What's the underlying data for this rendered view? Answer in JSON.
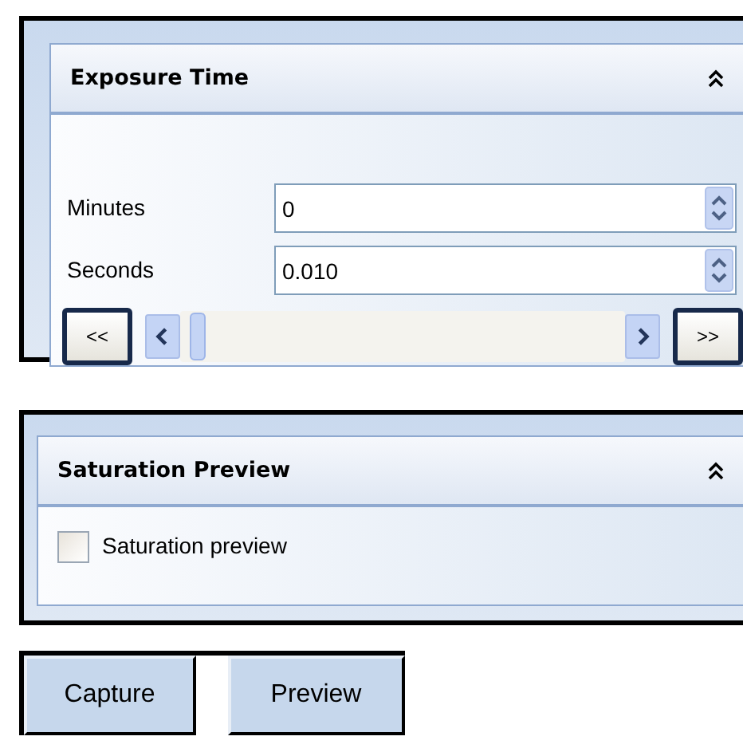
{
  "exposure_panel": {
    "title": "Exposure Time",
    "fields": [
      {
        "label": "Minutes",
        "value": "0"
      },
      {
        "label": "Seconds",
        "value": "0.010"
      }
    ],
    "slider": {
      "prev_button": "<<",
      "next_button": ">>",
      "level": 0.02
    }
  },
  "saturation_panel": {
    "title": "Saturation Preview",
    "checkbox": {
      "label": "Saturation preview",
      "checked": false
    }
  },
  "buttons": [
    {
      "label": "Capture"
    },
    {
      "label": "Preview"
    }
  ]
}
